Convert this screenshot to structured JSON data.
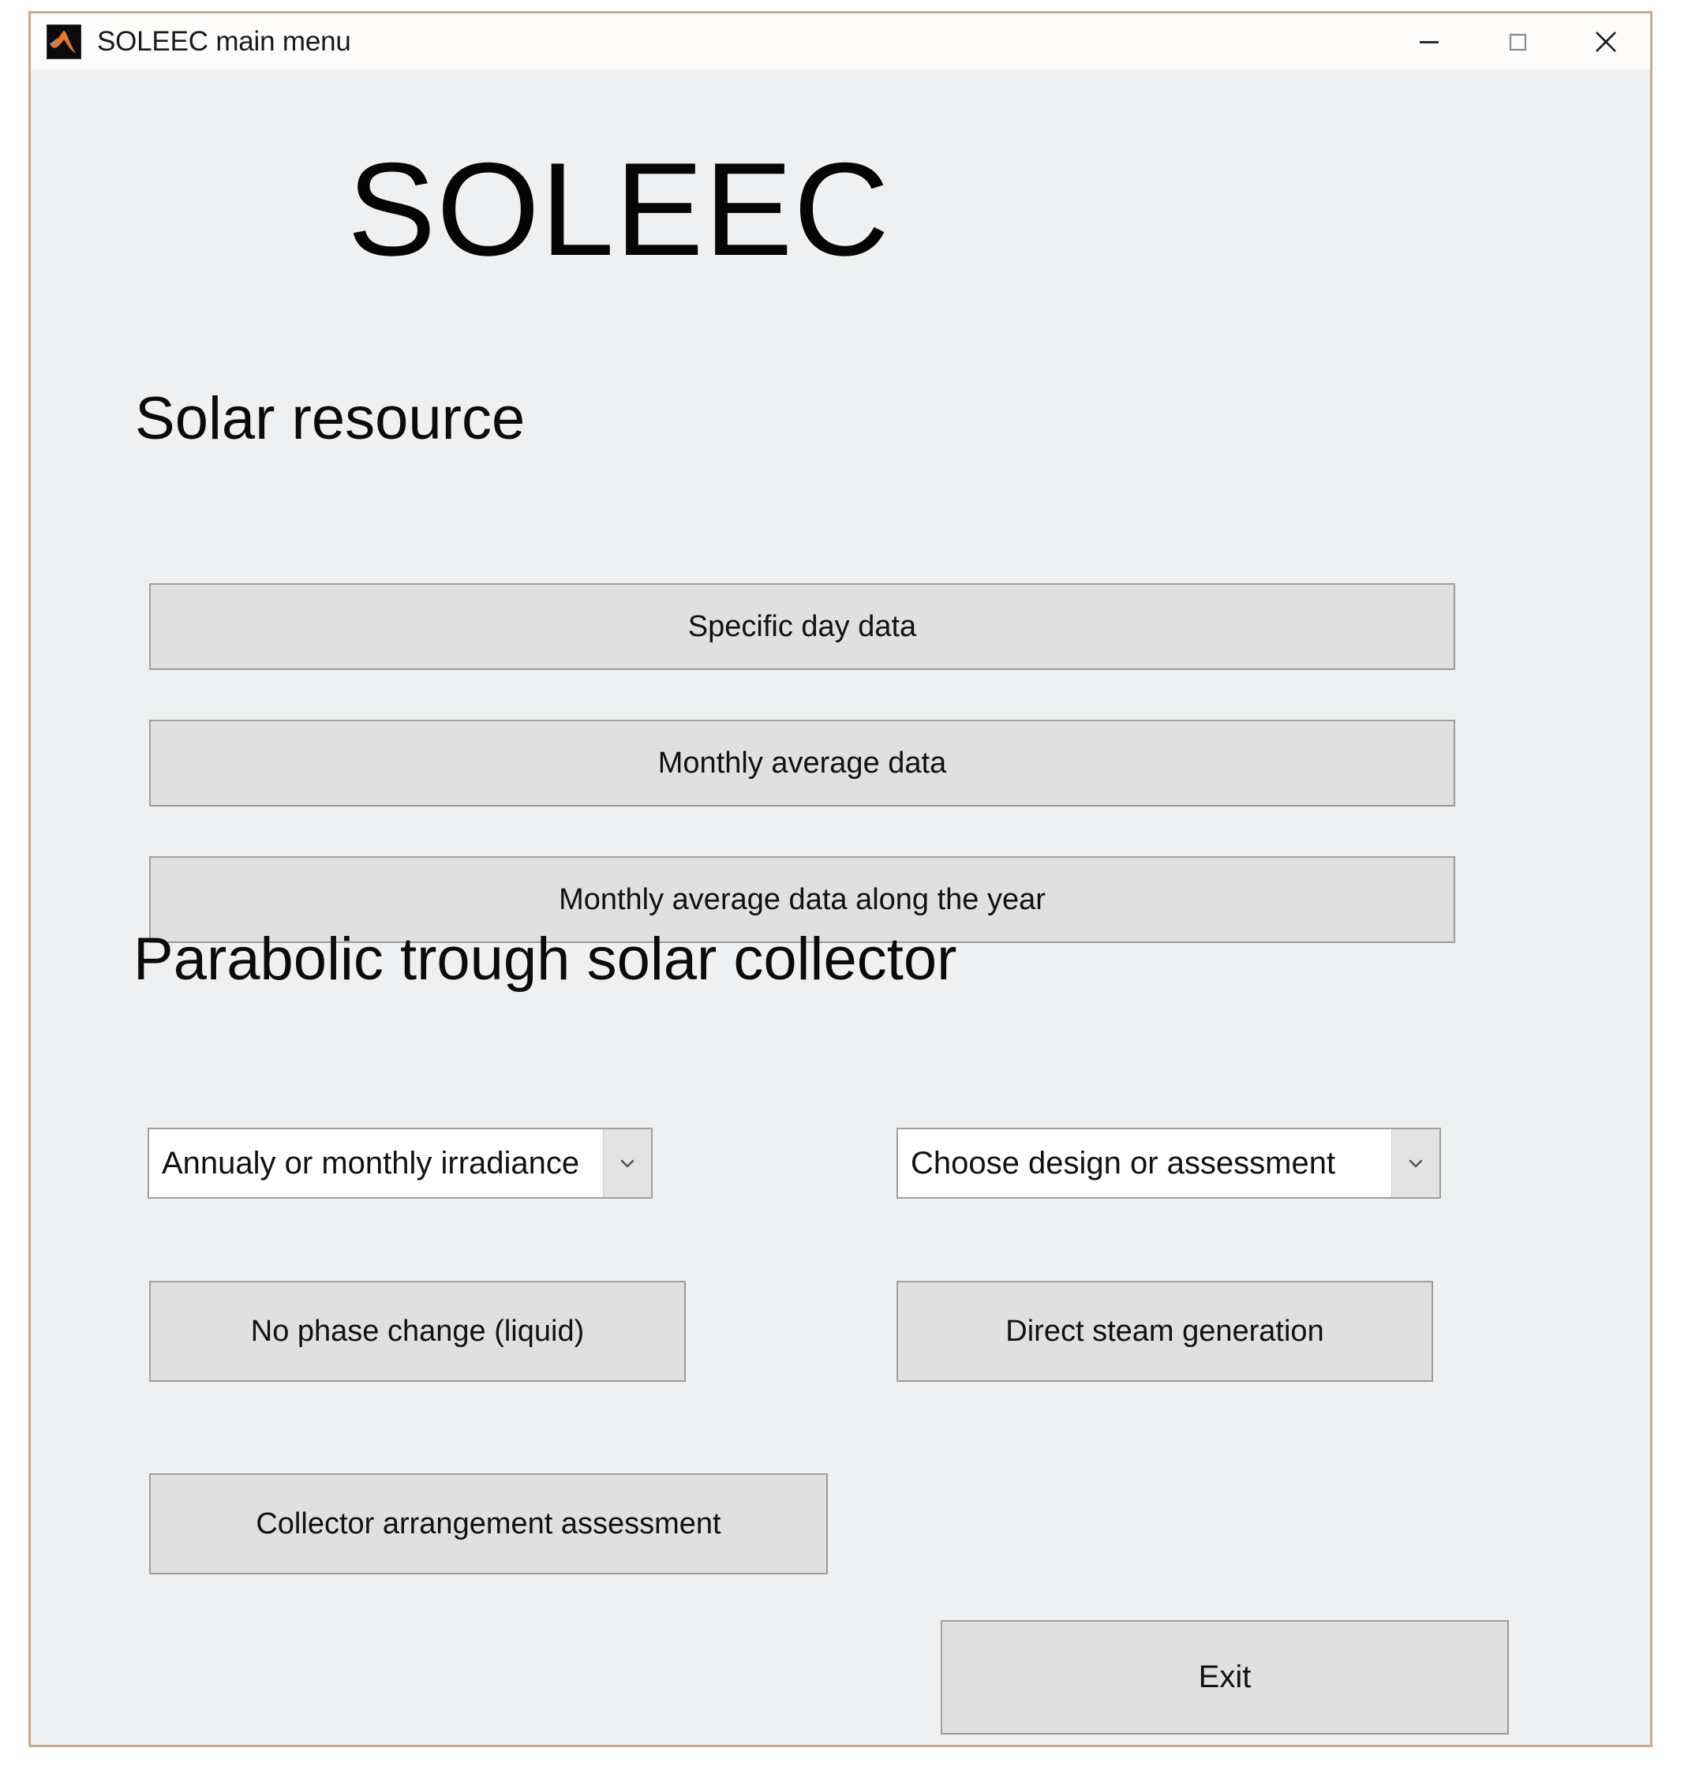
{
  "window": {
    "title": "SOLEEC main menu",
    "icon": "matlab-icon",
    "controls": {
      "minimize": "minimize-icon",
      "maximize": "maximize-icon",
      "close": "close-icon"
    },
    "border_color": "#c9ab86",
    "background_color": "#eff0f1"
  },
  "app": {
    "title": "SOLEEC"
  },
  "sections": [
    {
      "heading": "Solar resource",
      "buttons": [
        {
          "label": "Specific day data"
        },
        {
          "label": "Monthly average data"
        },
        {
          "label": "Monthly average data along the year"
        }
      ]
    },
    {
      "heading": "Parabolic trough solar collector",
      "dropdowns": [
        {
          "value": "Annualy or monthly irradiance",
          "arrow_icon": "chevron-down-icon"
        },
        {
          "value": "Choose design or assessment",
          "arrow_icon": "chevron-down-icon"
        }
      ],
      "buttons": [
        {
          "label": "No phase change (liquid)"
        },
        {
          "label": "Direct steam generation"
        },
        {
          "label": "Collector arrangement assessment"
        }
      ]
    }
  ],
  "footer": {
    "exit_label": "Exit"
  },
  "colors": {
    "button_face": "#e0e0e0",
    "button_border": "#a0a0a0",
    "panel": "#eff0f1",
    "titlebar": "#fdfcfb",
    "text": "#111111"
  }
}
